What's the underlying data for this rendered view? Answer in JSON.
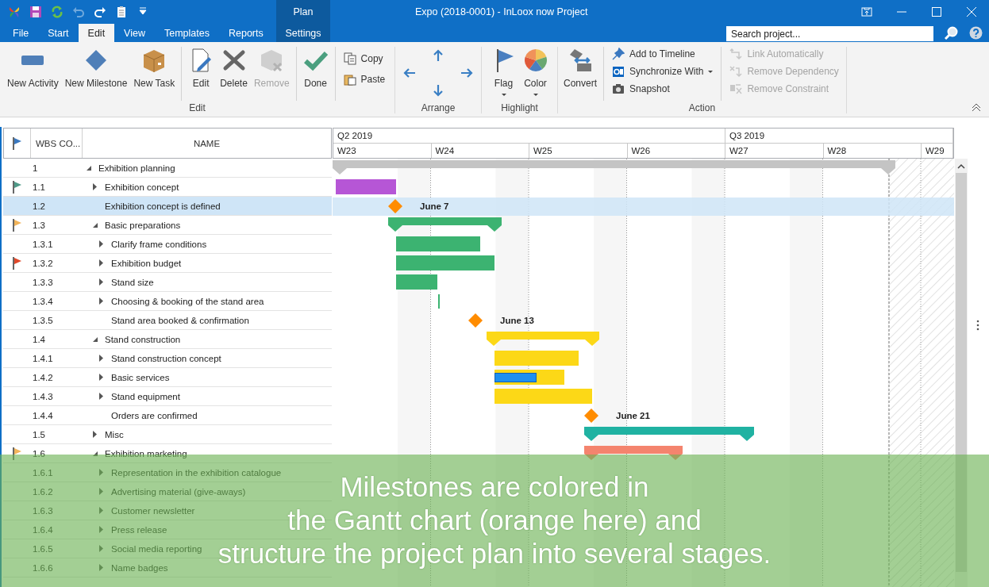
{
  "window": {
    "title": "Expo (2018-0001) - InLoox now Project",
    "context_tab": "Plan"
  },
  "quick_access": [
    {
      "disabled": false
    },
    {
      "disabled": false
    },
    {
      "disabled": false
    },
    {
      "disabled": true
    },
    {
      "disabled": false
    },
    {
      "disabled": false
    },
    {
      "disabled": false
    }
  ],
  "tabs": [
    {
      "label": "File",
      "selected": false,
      "contextual": false
    },
    {
      "label": "Start",
      "selected": false,
      "contextual": false
    },
    {
      "label": "Edit",
      "selected": true,
      "contextual": false
    },
    {
      "label": "View",
      "selected": false,
      "contextual": false
    },
    {
      "label": "Templates",
      "selected": false,
      "contextual": false
    },
    {
      "label": "Reports",
      "selected": false,
      "contextual": false
    },
    {
      "label": "Settings",
      "selected": false,
      "contextual": true
    }
  ],
  "search": {
    "placeholder": "Search project..."
  },
  "ribbon": {
    "groups": [
      {
        "label": "Edit",
        "columns": [
          {
            "kind": "large",
            "label": "New Activity",
            "disabled": false,
            "separated": false
          },
          {
            "kind": "large",
            "label": "New Milestone",
            "disabled": false,
            "separated": false
          },
          {
            "kind": "large",
            "label": "New Task",
            "disabled": false,
            "separated": false
          },
          {
            "kind": "large",
            "label": "Edit",
            "disabled": false,
            "separated": true
          },
          {
            "kind": "large",
            "label": "Delete",
            "disabled": false,
            "separated": false
          },
          {
            "kind": "large",
            "label": "Remove",
            "disabled": true,
            "separated": false
          },
          {
            "kind": "large",
            "label": "Done",
            "disabled": false,
            "separated": true
          },
          {
            "kind": "stack",
            "separated": true,
            "items": [
              {
                "label": "Copy",
                "disabled": false,
                "dropdown": false
              },
              {
                "label": "Paste",
                "disabled": false,
                "dropdown": false
              }
            ]
          }
        ]
      },
      {
        "label": "Arrange",
        "columns": [
          {
            "kind": "arrows",
            "separated": false
          }
        ]
      },
      {
        "label": "Highlight",
        "columns": [
          {
            "kind": "large",
            "label": "Flag",
            "disabled": false,
            "separated": false,
            "dropdown": true
          },
          {
            "kind": "large",
            "label": "Color",
            "disabled": false,
            "separated": false,
            "dropdown": true
          }
        ]
      },
      {
        "label": "Action",
        "columns": [
          {
            "kind": "large",
            "label": "Convert",
            "disabled": false,
            "separated": false
          },
          {
            "kind": "stack",
            "separated": true,
            "items": [
              {
                "label": "Add to Timeline",
                "disabled": false,
                "dropdown": false
              },
              {
                "label": "Synchronize With",
                "disabled": false,
                "dropdown": true
              },
              {
                "label": "Snapshot",
                "disabled": false,
                "dropdown": false
              }
            ]
          },
          {
            "kind": "stack",
            "separated": true,
            "items": [
              {
                "label": "Link Automatically",
                "disabled": true,
                "dropdown": false
              },
              {
                "label": "Remove Dependency",
                "disabled": true,
                "dropdown": false
              },
              {
                "label": "Remove Constraint",
                "disabled": true,
                "dropdown": false
              }
            ]
          }
        ]
      }
    ]
  },
  "table": {
    "columns": [
      {
        "kind": "flag"
      },
      {
        "kind": "text",
        "label": "WBS CO..."
      },
      {
        "kind": "text",
        "label": "NAME"
      }
    ]
  },
  "tasks": [
    {
      "wbs": "1",
      "name": "Exhibition planning",
      "kind": "summary",
      "expanded": true,
      "selected": false,
      "color": "#c4c4c4",
      "children": [
        {
          "wbs": "1.1",
          "name": "Exhibition concept",
          "kind": "task",
          "expanded": false,
          "selected": false,
          "flag": {
            "color": "#4f9a88"
          },
          "color": "#b656d6"
        },
        {
          "wbs": "1.2",
          "name": "Exhibition concept is defined",
          "kind": "milestone",
          "selected": true,
          "color": "#ff8c00",
          "date_label": "June 7"
        },
        {
          "wbs": "1.3",
          "name": "Basic preparations",
          "kind": "summary",
          "expanded": true,
          "selected": false,
          "flag": {
            "color": "#f2b45a"
          },
          "color": "#3cb371",
          "children": [
            {
              "wbs": "1.3.1",
              "name": "Clarify frame conditions",
              "kind": "task",
              "expanded": false,
              "selected": false,
              "color": "#3cb371"
            },
            {
              "wbs": "1.3.2",
              "name": "Exhibition budget",
              "kind": "task",
              "expanded": false,
              "selected": false,
              "flag": {
                "color": "#e0482a"
              },
              "color": "#3cb371"
            },
            {
              "wbs": "1.3.3",
              "name": "Stand size",
              "kind": "task",
              "expanded": false,
              "selected": false,
              "color": "#3cb371"
            },
            {
              "wbs": "1.3.4",
              "name": "Choosing & booking of the stand area",
              "kind": "task",
              "expanded": false,
              "selected": false,
              "color": "#3cb371"
            },
            {
              "wbs": "1.3.5",
              "name": "Stand area booked & confirmation",
              "kind": "milestone",
              "selected": false,
              "color": "#ff8c00",
              "date_label": "June 13"
            }
          ]
        },
        {
          "wbs": "1.4",
          "name": "Stand construction",
          "kind": "summary",
          "expanded": true,
          "selected": false,
          "color": "#fcd817",
          "children": [
            {
              "wbs": "1.4.1",
              "name": "Stand construction concept",
              "kind": "task",
              "expanded": false,
              "selected": false,
              "color": "#fcd817"
            },
            {
              "wbs": "1.4.2",
              "name": "Basic services",
              "kind": "task",
              "expanded": false,
              "selected": false,
              "color": "#fcd817",
              "level": 0.59
            },
            {
              "wbs": "1.4.3",
              "name": "Stand equipment",
              "kind": "task",
              "expanded": false,
              "selected": false,
              "color": "#fcd817"
            },
            {
              "wbs": "1.4.4",
              "name": "Orders are confirmed",
              "kind": "milestone",
              "selected": false,
              "color": "#ff8c00",
              "date_label": "June 21"
            }
          ]
        },
        {
          "wbs": "1.5",
          "name": "Misc",
          "kind": "summary",
          "expanded": false,
          "selected": false,
          "color": "#20b2a2"
        },
        {
          "wbs": "1.6",
          "name": "Exhibition marketing",
          "kind": "summary",
          "expanded": true,
          "selected": false,
          "flag": {
            "color": "#f2b45a"
          },
          "color": "#f4846e",
          "children": [
            {
              "wbs": "1.6.1",
              "name": "Representation in the exhibition catalogue",
              "kind": "task",
              "expanded": false,
              "selected": false
            },
            {
              "wbs": "1.6.2",
              "name": "Advertising material (give-aways)",
              "kind": "task",
              "expanded": false,
              "selected": false
            },
            {
              "wbs": "1.6.3",
              "name": "Customer newsletter",
              "kind": "task",
              "expanded": false,
              "selected": false
            },
            {
              "wbs": "1.6.4",
              "name": "Press release",
              "kind": "task",
              "expanded": false,
              "selected": false
            },
            {
              "wbs": "1.6.5",
              "name": "Social media reporting",
              "kind": "task",
              "expanded": false,
              "selected": false
            },
            {
              "wbs": "1.6.6",
              "name": "Name badges",
              "kind": "task",
              "expanded": false,
              "selected": false
            }
          ]
        }
      ]
    }
  ],
  "timescale": {
    "quarters": [
      "Q2 2019",
      "Q3 2019"
    ],
    "weeks": [
      "W23",
      "W24",
      "W25",
      "W26",
      "W27",
      "W28",
      "W29"
    ]
  },
  "caption": {
    "lines": [
      "Milestones are colored in",
      "the Gantt chart (orange here) and",
      "structure the project plan into several stages."
    ]
  }
}
